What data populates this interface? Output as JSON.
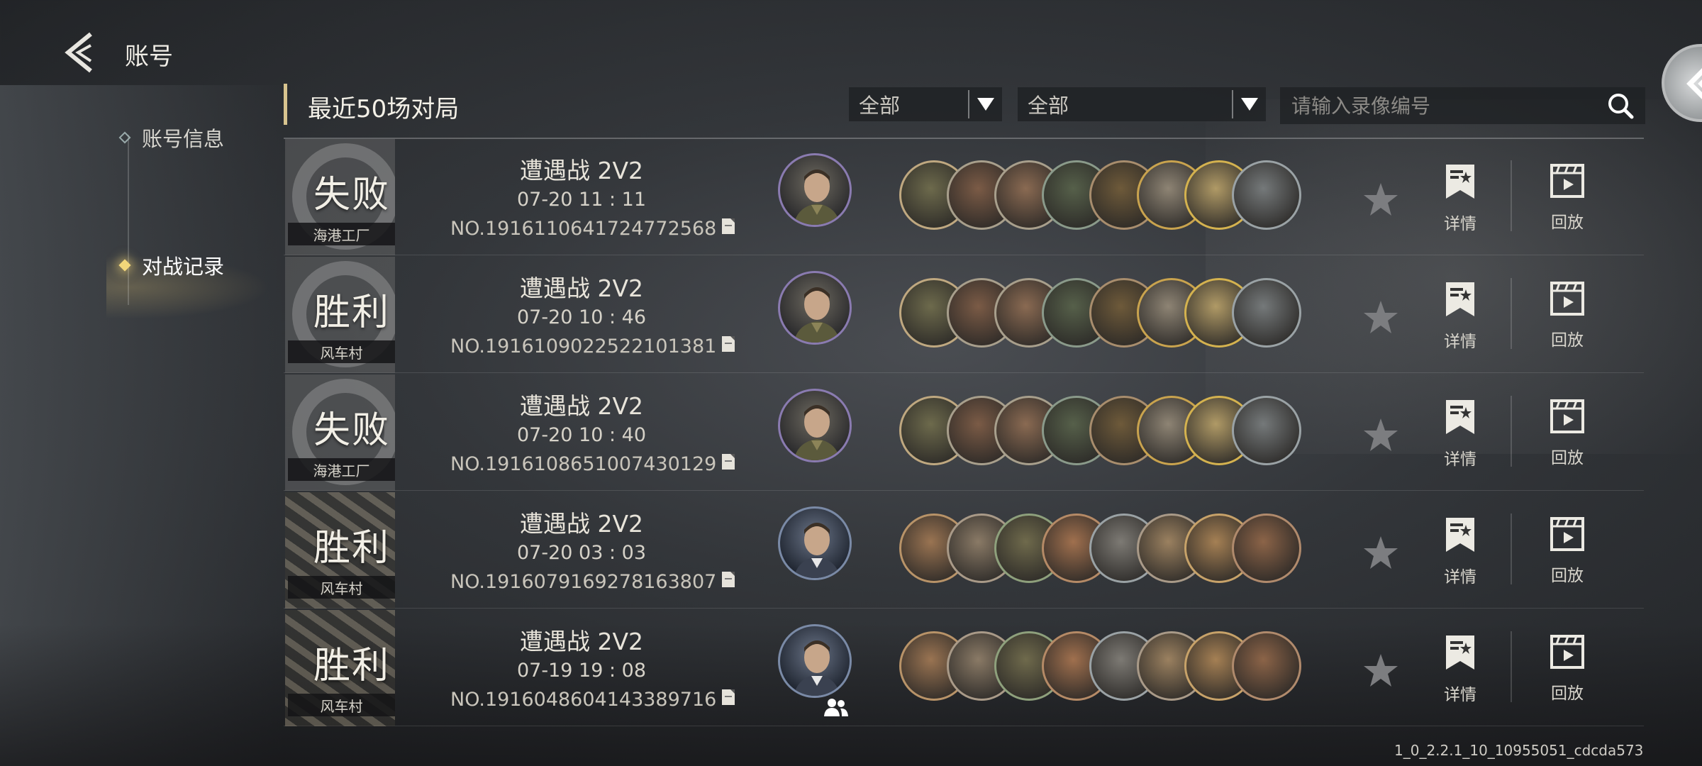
{
  "header": {
    "title": "账号"
  },
  "side_nav": {
    "items": [
      {
        "label": "账号信息",
        "active": false
      },
      {
        "label": "对战记录",
        "active": true
      }
    ]
  },
  "toolbar": {
    "section_title": "最近50场对局",
    "filter1": {
      "selected": "全部"
    },
    "filter2": {
      "selected": "全部"
    },
    "search": {
      "placeholder": "请输入录像编号",
      "value": ""
    }
  },
  "rows": [
    {
      "result": "失败",
      "map": "海港工厂",
      "mode": "遭遇战 2V2",
      "datetime": "07-20  11 : 11",
      "record_no": "NO.1916110641724772568",
      "faction": "bear",
      "commander": "olive",
      "team": false,
      "units_theme": "green"
    },
    {
      "result": "胜利",
      "map": "风车村",
      "mode": "遭遇战 2V2",
      "datetime": "07-20  10 : 46",
      "record_no": "NO.1916109022522101381",
      "faction": "bear",
      "commander": "olive",
      "team": false,
      "units_theme": "green"
    },
    {
      "result": "失败",
      "map": "海港工厂",
      "mode": "遭遇战 2V2",
      "datetime": "07-20  10 : 40",
      "record_no": "NO.1916108651007430129",
      "faction": "bear",
      "commander": "olive",
      "team": false,
      "units_theme": "green"
    },
    {
      "result": "胜利",
      "map": "风车村",
      "mode": "遭遇战 2V2",
      "datetime": "07-20  03 : 03",
      "record_no": "NO.1916079169278163807",
      "faction": "tiger",
      "commander": "navy",
      "team": false,
      "units_theme": "desert"
    },
    {
      "result": "胜利",
      "map": "风车村",
      "mode": "遭遇战 2V2",
      "datetime": "07-19  19 : 08",
      "record_no": "NO.1916048604143389716",
      "faction": "tiger",
      "commander": "navy",
      "team": true,
      "units_theme": "desert"
    }
  ],
  "buttons": {
    "detail_label": "详情",
    "replay_label": "回放"
  },
  "version": "1_0_2.2.1_10_10955051_cdcda573"
}
